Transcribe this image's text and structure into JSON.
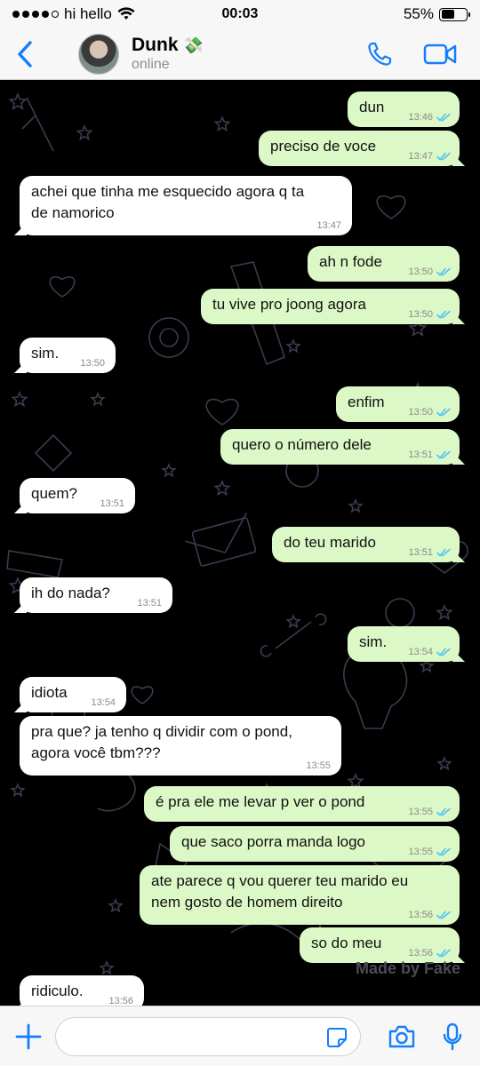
{
  "status_bar": {
    "carrier": "hi hello",
    "time": "00:03",
    "battery_percent": "55%",
    "battery_level": 0.55,
    "signal_bars": 4
  },
  "header": {
    "contact_name": "Dunk",
    "contact_emoji": "💸",
    "status": "online"
  },
  "messages": [
    {
      "dir": "out",
      "text": "dun",
      "time": "13:46",
      "read": true
    },
    {
      "dir": "out",
      "text": "preciso de voce",
      "time": "13:47",
      "read": true
    },
    {
      "dir": "in",
      "lines": [
        "achei que tinha me esquecido agora q ta",
        "de namorico"
      ],
      "time": "13:47"
    },
    {
      "dir": "out",
      "text": "ah n fode",
      "time": "13:50",
      "read": true
    },
    {
      "dir": "out",
      "text": "tu vive pro joong agora",
      "time": "13:50",
      "read": true
    },
    {
      "dir": "in",
      "text": "sim.",
      "time": "13:50"
    },
    {
      "dir": "out",
      "text": "enfim",
      "time": "13:50",
      "read": true
    },
    {
      "dir": "out",
      "text": "quero o número dele",
      "time": "13:51",
      "read": true
    },
    {
      "dir": "in",
      "text": "quem?",
      "time": "13:51"
    },
    {
      "dir": "out",
      "text": "do teu marido",
      "time": "13:51",
      "read": true
    },
    {
      "dir": "in",
      "text": "ih do nada?",
      "time": "13:51"
    },
    {
      "dir": "out",
      "text": "sim.",
      "time": "13:54",
      "read": true
    },
    {
      "dir": "in",
      "text": "idiota",
      "time": "13:54"
    },
    {
      "dir": "in",
      "lines": [
        "pra que? ja tenho q dividir com o pond,",
        "agora você tbm???"
      ],
      "time": "13:55"
    },
    {
      "dir": "out",
      "text": "é pra ele me levar p ver o pond",
      "time": "13:55",
      "read": true
    },
    {
      "dir": "out",
      "text": "que saco porra manda logo",
      "time": "13:55",
      "read": true
    },
    {
      "dir": "out",
      "lines": [
        "ate parece q vou querer teu marido eu",
        "nem gosto de homem direito"
      ],
      "time": "13:56",
      "read": true
    },
    {
      "dir": "out",
      "text": "so do meu",
      "time": "13:56",
      "read": true
    },
    {
      "dir": "in",
      "text": "ridiculo.",
      "time": "13:56"
    }
  ],
  "watermark": "Made by Fake",
  "input": {
    "placeholder": ""
  },
  "colors": {
    "accent": "#147efb",
    "outgoing_bubble": "#dcf8c6",
    "incoming_bubble": "#ffffff",
    "read_ticks": "#4fc3f7",
    "wallpaper_lines": "#3d3a4f"
  },
  "icons": [
    "back-chevron-icon",
    "phone-icon",
    "video-call-icon",
    "plus-icon",
    "sticker-icon",
    "camera-icon",
    "microphone-icon",
    "wifi-icon",
    "double-check-icon"
  ]
}
